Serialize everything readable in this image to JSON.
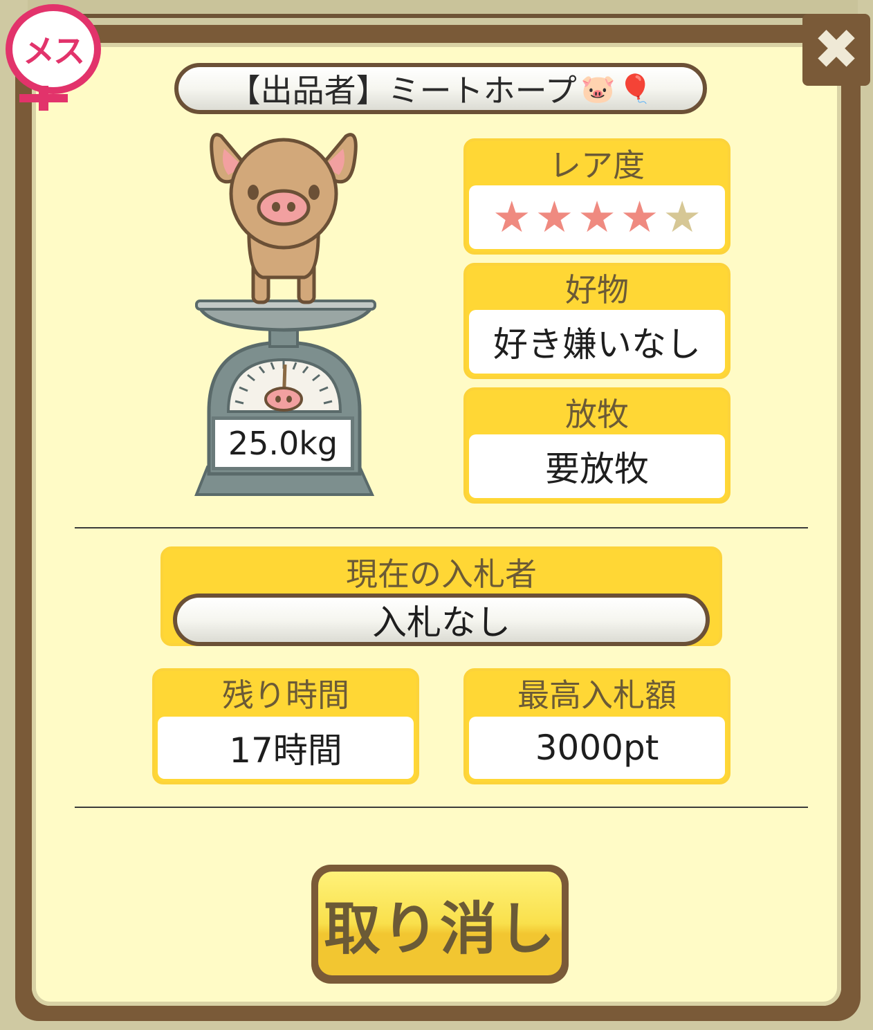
{
  "seller": {
    "text": "【出品者】ミートホープ",
    "pig_icon": "🐷",
    "balloon_icon": "🎈"
  },
  "sex_badge": {
    "label": "メス"
  },
  "close_icon": "✖",
  "pig": {
    "weight": "25.0kg"
  },
  "rarity": {
    "label": "レア度",
    "stars_filled": 4,
    "stars_total": 5
  },
  "favorite_food": {
    "label": "好物",
    "value": "好き嫌いなし"
  },
  "grazing": {
    "label": "放牧",
    "value": "要放牧"
  },
  "current_bidder": {
    "label": "現在の入札者",
    "value": "入札なし"
  },
  "remaining_time": {
    "label": "残り時間",
    "value": "17時間"
  },
  "highest_bid": {
    "label": "最高入札額",
    "value": "3000pt"
  },
  "cancel_button": {
    "label": "取り消し"
  },
  "colors": {
    "frame_brown": "#7a5a38",
    "panel_bg": "#fffbc6",
    "card_yellow": "#ffd735",
    "female_pink": "#e2336b",
    "star_on": "#ef8a80",
    "star_off": "#d6c795"
  }
}
